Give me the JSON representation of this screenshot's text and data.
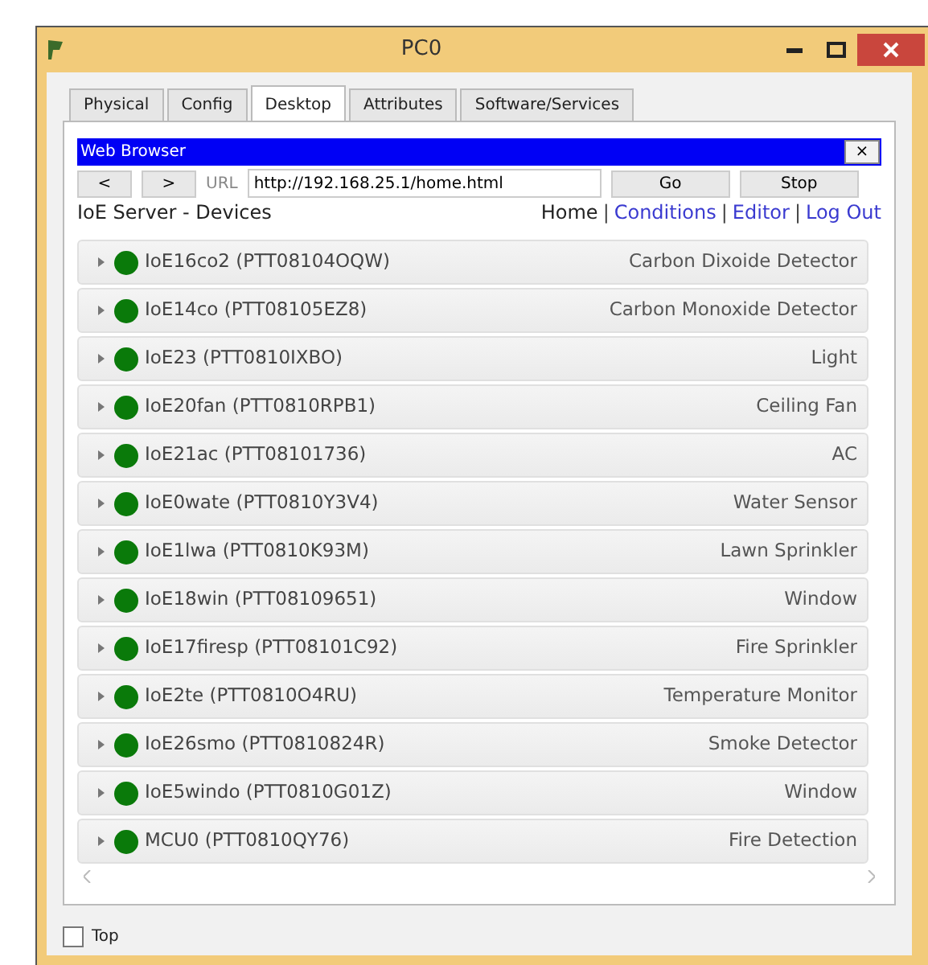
{
  "window": {
    "title": "PC0"
  },
  "tabs": [
    {
      "label": "Physical",
      "selected": false
    },
    {
      "label": "Config",
      "selected": false
    },
    {
      "label": "Desktop",
      "selected": true
    },
    {
      "label": "Attributes",
      "selected": false
    },
    {
      "label": "Software/Services",
      "selected": false
    }
  ],
  "browser": {
    "title": "Web Browser",
    "close": "×",
    "back": "<",
    "forward": ">",
    "url_label": "URL",
    "url": "http://192.168.25.1/home.html",
    "go": "Go",
    "stop": "Stop"
  },
  "page": {
    "heading": "IoE Server - Devices",
    "links": [
      {
        "label": "Home",
        "current": true
      },
      {
        "separator": "|",
        "label": "Conditions",
        "current": false
      },
      {
        "separator": "|",
        "label": "Editor",
        "current": false
      },
      {
        "separator": "|",
        "label": "Log Out",
        "current": false
      }
    ],
    "devices": [
      {
        "name": "IoE16co2 (PTT08104OQW)",
        "type": "Carbon Dixoide Detector",
        "color": "#0a7a0a"
      },
      {
        "name": "IoE14co (PTT08105EZ8)",
        "type": "Carbon Monoxide Detector",
        "color": "#0a7a0a"
      },
      {
        "name": "IoE23 (PTT0810IXBO)",
        "type": "Light",
        "color": "#0a7a0a"
      },
      {
        "name": "IoE20fan (PTT0810RPB1)",
        "type": "Ceiling Fan",
        "color": "#0a7a0a"
      },
      {
        "name": "IoE21ac (PTT08101736)",
        "type": "AC",
        "color": "#0a7a0a"
      },
      {
        "name": "IoE0wate (PTT0810Y3V4)",
        "type": "Water Sensor",
        "color": "#0a7a0a"
      },
      {
        "name": "IoE1lwa (PTT0810K93M)",
        "type": "Lawn Sprinkler",
        "color": "#0a7a0a"
      },
      {
        "name": "IoE18win (PTT08109651)",
        "type": "Window",
        "color": "#0a7a0a"
      },
      {
        "name": "IoE17firesp (PTT08101C92)",
        "type": "Fire Sprinkler",
        "color": "#0a7a0a"
      },
      {
        "name": "IoE2te (PTT0810O4RU)",
        "type": "Temperature Monitor",
        "color": "#0a7a0a"
      },
      {
        "name": "IoE26smo (PTT0810824R)",
        "type": "Smoke Detector",
        "color": "#0a7a0a"
      },
      {
        "name": "IoE5windo (PTT0810G01Z)",
        "type": "Window",
        "color": "#0a7a0a"
      },
      {
        "name": "MCU0 (PTT0810QY76)",
        "type": "Fire Detection",
        "color": "#0a7a0a"
      }
    ]
  },
  "top_checkbox": {
    "label": "Top",
    "checked": false
  }
}
